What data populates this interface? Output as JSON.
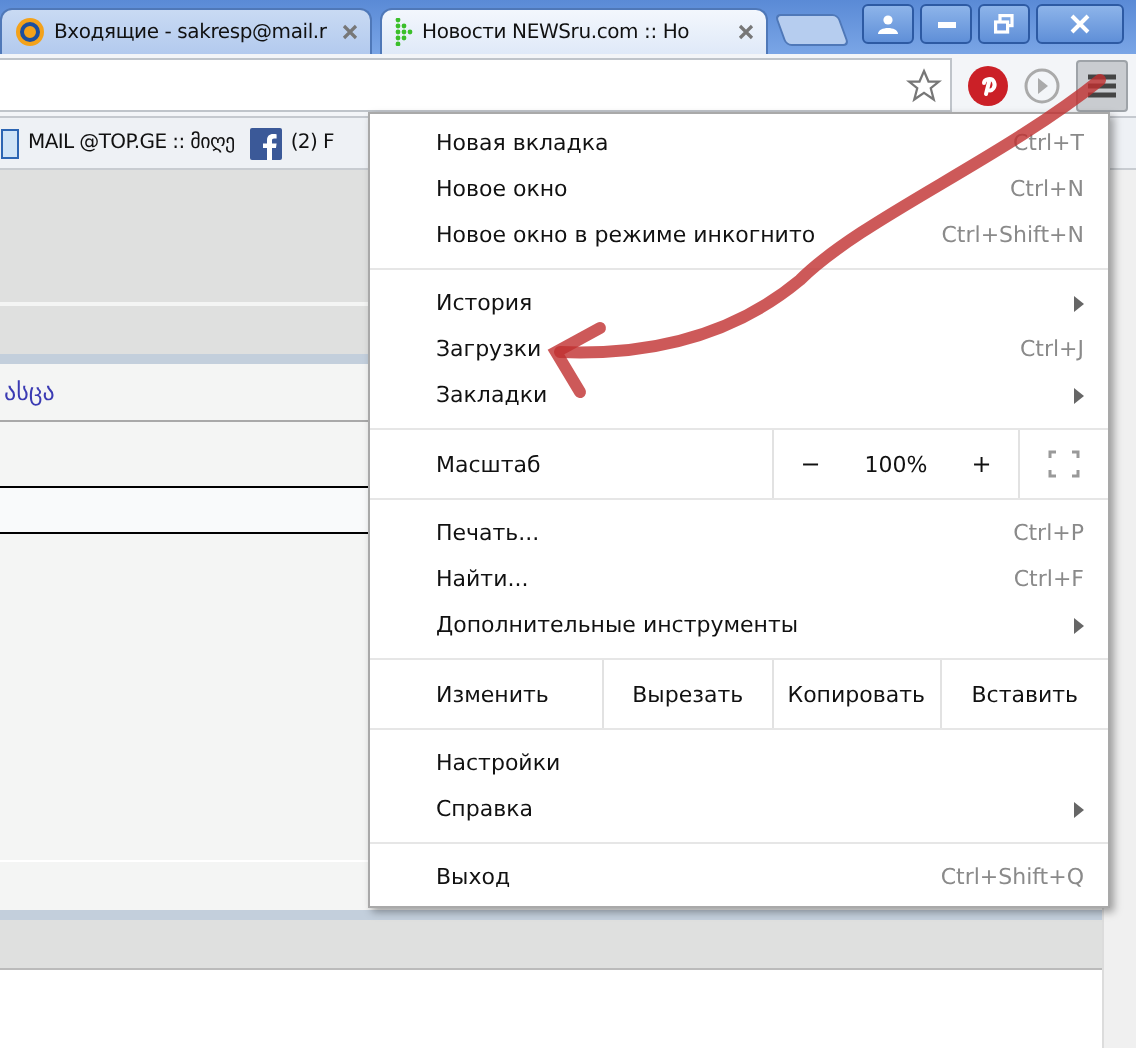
{
  "tabs": [
    {
      "title": "Входящие - sakresp@mail.r",
      "selected": false
    },
    {
      "title": "Новости NEWSru.com :: Но",
      "selected": true
    }
  ],
  "bookmarks": [
    {
      "label": "MAIL @TOP.GE :: მიღე"
    },
    {
      "label": "(2) F"
    }
  ],
  "page": {
    "link_text": "ასცა"
  },
  "menu": [
    {
      "kind": "item",
      "label": "Новая вкладка",
      "shortcut": "Ctrl+T",
      "submenu": false
    },
    {
      "kind": "item",
      "label": "Новое окно",
      "shortcut": "Ctrl+N",
      "submenu": false
    },
    {
      "kind": "item",
      "label": "Новое окно в режиме инкогнито",
      "shortcut": "Ctrl+Shift+N",
      "submenu": false
    },
    {
      "kind": "separator"
    },
    {
      "kind": "item",
      "label": "История",
      "submenu": true
    },
    {
      "kind": "item",
      "label": "Загрузки",
      "shortcut": "Ctrl+J",
      "submenu": false
    },
    {
      "kind": "item",
      "label": "Закладки",
      "submenu": true
    },
    {
      "kind": "separator"
    },
    {
      "kind": "zoom",
      "label": "Масштаб",
      "minus": "−",
      "value": "100%",
      "plus": "+"
    },
    {
      "kind": "separator"
    },
    {
      "kind": "item",
      "label": "Печать...",
      "shortcut": "Ctrl+P",
      "submenu": false
    },
    {
      "kind": "item",
      "label": "Найти...",
      "shortcut": "Ctrl+F",
      "submenu": false
    },
    {
      "kind": "item",
      "label": "Дополнительные инструменты",
      "submenu": true
    },
    {
      "kind": "separator"
    },
    {
      "kind": "edit",
      "label": "Изменить",
      "buttons": [
        "Вырезать",
        "Копировать",
        "Вставить"
      ]
    },
    {
      "kind": "separator"
    },
    {
      "kind": "item",
      "label": "Настройки",
      "submenu": false
    },
    {
      "kind": "item",
      "label": "Справка",
      "submenu": true
    },
    {
      "kind": "separator"
    },
    {
      "kind": "item",
      "label": "Выход",
      "shortcut": "Ctrl+Shift+Q",
      "submenu": false
    }
  ]
}
